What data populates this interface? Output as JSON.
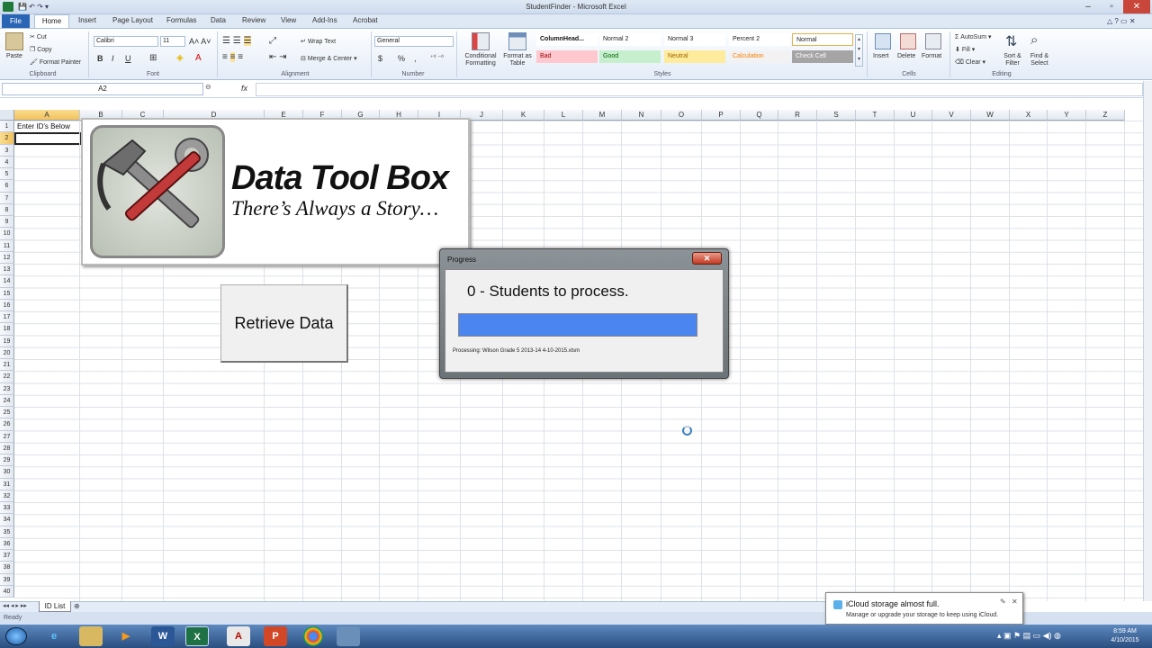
{
  "window": {
    "title": "StudentFinder - Microsoft Excel"
  },
  "ribbon_tabs": [
    "Insert",
    "Page Layout",
    "Formulas",
    "Data",
    "Review",
    "View",
    "Add-Ins",
    "Acrobat"
  ],
  "file_tab": "File",
  "home_tab": "Home",
  "clipboard": {
    "paste": "Paste",
    "cut": "Cut",
    "copy": "Copy",
    "format_painter": "Format Painter",
    "label": "Clipboard"
  },
  "font": {
    "name": "Calibri",
    "size": "11",
    "label": "Font",
    "bold": "B",
    "italic": "I",
    "underline": "U"
  },
  "alignment": {
    "wrap": "Wrap Text",
    "merge": "Merge & Center",
    "label": "Alignment"
  },
  "number": {
    "format": "General",
    "currency": "$",
    "percent": "%",
    "comma": ",",
    "label": "Number"
  },
  "styles": {
    "conditional": "Conditional Formatting",
    "format_table": "Format as Table",
    "cells": [
      {
        "label": "ColumnHead...",
        "bg": "#ffffff",
        "fg": "#111111"
      },
      {
        "label": "Normal 2",
        "bg": "#ffffff",
        "fg": "#222222"
      },
      {
        "label": "Normal 3",
        "bg": "#ffffff",
        "fg": "#222222"
      },
      {
        "label": "Percent 2",
        "bg": "#ffffff",
        "fg": "#222222"
      },
      {
        "label": "Normal",
        "bg": "#ffffff",
        "fg": "#222222"
      },
      {
        "label": "Bad",
        "bg": "#ffc7ce",
        "fg": "#9c0006"
      },
      {
        "label": "Good",
        "bg": "#c6efce",
        "fg": "#006100"
      },
      {
        "label": "Neutral",
        "bg": "#ffeb9c",
        "fg": "#9c6500"
      },
      {
        "label": "Calculation",
        "bg": "#f2f2f2",
        "fg": "#fa7d00"
      },
      {
        "label": "Check Cell",
        "bg": "#a5a5a5",
        "fg": "#ffffff"
      }
    ],
    "label": "Styles"
  },
  "cells_group": {
    "insert": "Insert",
    "delete": "Delete",
    "format": "Format",
    "label": "Cells"
  },
  "editing": {
    "autosum": "AutoSum",
    "fill": "Fill",
    "clear": "Clear",
    "sort": "Sort & Filter",
    "find": "Find & Select",
    "label": "Editing"
  },
  "formula_bar": {
    "name_box": "A2",
    "fx": "fx"
  },
  "columns": [
    "A",
    "B",
    "C",
    "D",
    "E",
    "F",
    "G",
    "H",
    "I",
    "J",
    "K",
    "L",
    "M",
    "N",
    "O",
    "P",
    "Q",
    "R",
    "S",
    "T",
    "U",
    "V",
    "W",
    "X",
    "Y",
    "Z"
  ],
  "rows": [
    "1",
    "2",
    "3",
    "4",
    "5",
    "6",
    "7",
    "8",
    "9",
    "10",
    "11",
    "12",
    "13",
    "14",
    "15",
    "16",
    "17",
    "18",
    "19",
    "20",
    "21",
    "22",
    "23",
    "24",
    "25",
    "26",
    "27",
    "28",
    "29",
    "30",
    "31",
    "32",
    "33",
    "34",
    "35",
    "36",
    "37",
    "38",
    "39",
    "40"
  ],
  "cell_a1": "Enter ID's Below",
  "logo": {
    "title": "Data Tool Box",
    "subtitle": "There’s Always a Story…"
  },
  "retrieve_button": "Retrieve Data",
  "progress_dialog": {
    "title": "Progress",
    "message": "0 - Students to process.",
    "progress": 1.0,
    "processing": "Processing: Wilson Grade 5 2013-14 4-10-2015.xlsm",
    "fill_color": "#4a85f0"
  },
  "sheet_tab": "ID List",
  "status": "Ready",
  "notification": {
    "title": "iCloud storage almost full.",
    "body": "Manage or upgrade your storage to keep using iCloud."
  },
  "clock": {
    "time": "8:59 AM",
    "date": "4/10/2015"
  },
  "taskbar_apps": [
    "ie-icon",
    "explorer-icon",
    "media-icon",
    "word-icon",
    "excel-icon",
    "acrobat-icon",
    "powerpoint-icon",
    "chrome-icon",
    "app-icon"
  ]
}
